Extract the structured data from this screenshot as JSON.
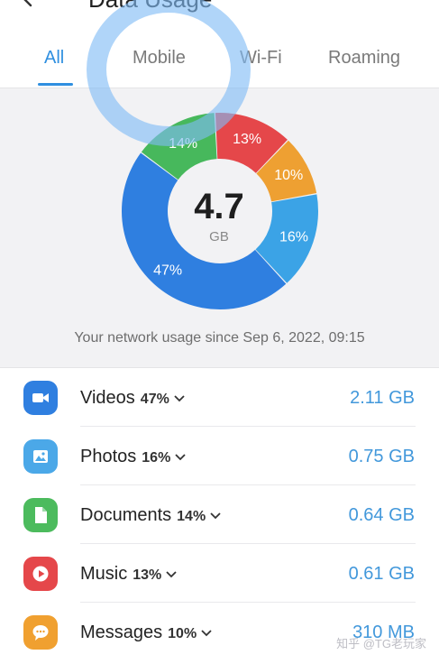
{
  "header": {
    "title": "Data Usage"
  },
  "tabs": [
    {
      "label": "All",
      "active": true
    },
    {
      "label": "Mobile",
      "active": false
    },
    {
      "label": "Wi-Fi",
      "active": false
    },
    {
      "label": "Roaming",
      "active": false
    }
  ],
  "summary": {
    "total_value": "4.7",
    "total_unit": "GB",
    "since_text": "Your network usage since Sep 6, 2022, 09:15"
  },
  "chart_data": {
    "type": "pie",
    "categories": [
      "Videos",
      "Photos",
      "Documents",
      "Music",
      "Messages"
    ],
    "values": [
      47,
      16,
      14,
      13,
      10
    ],
    "labels": [
      "47%",
      "16%",
      "14%",
      "13%",
      "10%"
    ],
    "colors": [
      "#2f7fe0",
      "#3ba3e6",
      "#47b85c",
      "#e5474a",
      "#eea032"
    ],
    "ordering": [
      "Music",
      "Messages",
      "Photos",
      "Videos",
      "Documents"
    ],
    "donut": true
  },
  "categories": [
    {
      "name": "Videos",
      "percent": "47%",
      "size": "2.11 GB",
      "color": "#2f7fe0",
      "icon": "video-camera-icon"
    },
    {
      "name": "Photos",
      "percent": "16%",
      "size": "0.75 GB",
      "color": "#4ba8e8",
      "icon": "image-icon"
    },
    {
      "name": "Documents",
      "percent": "14%",
      "size": "0.64 GB",
      "color": "#4cbb5d",
      "icon": "document-icon"
    },
    {
      "name": "Music",
      "percent": "13%",
      "size": "0.61 GB",
      "color": "#e5474a",
      "icon": "play-icon"
    },
    {
      "name": "Messages",
      "percent": "10%",
      "size": "310 MB",
      "color": "#f0a030",
      "icon": "message-icon"
    }
  ],
  "watermark": "知乎 @TG老玩家"
}
